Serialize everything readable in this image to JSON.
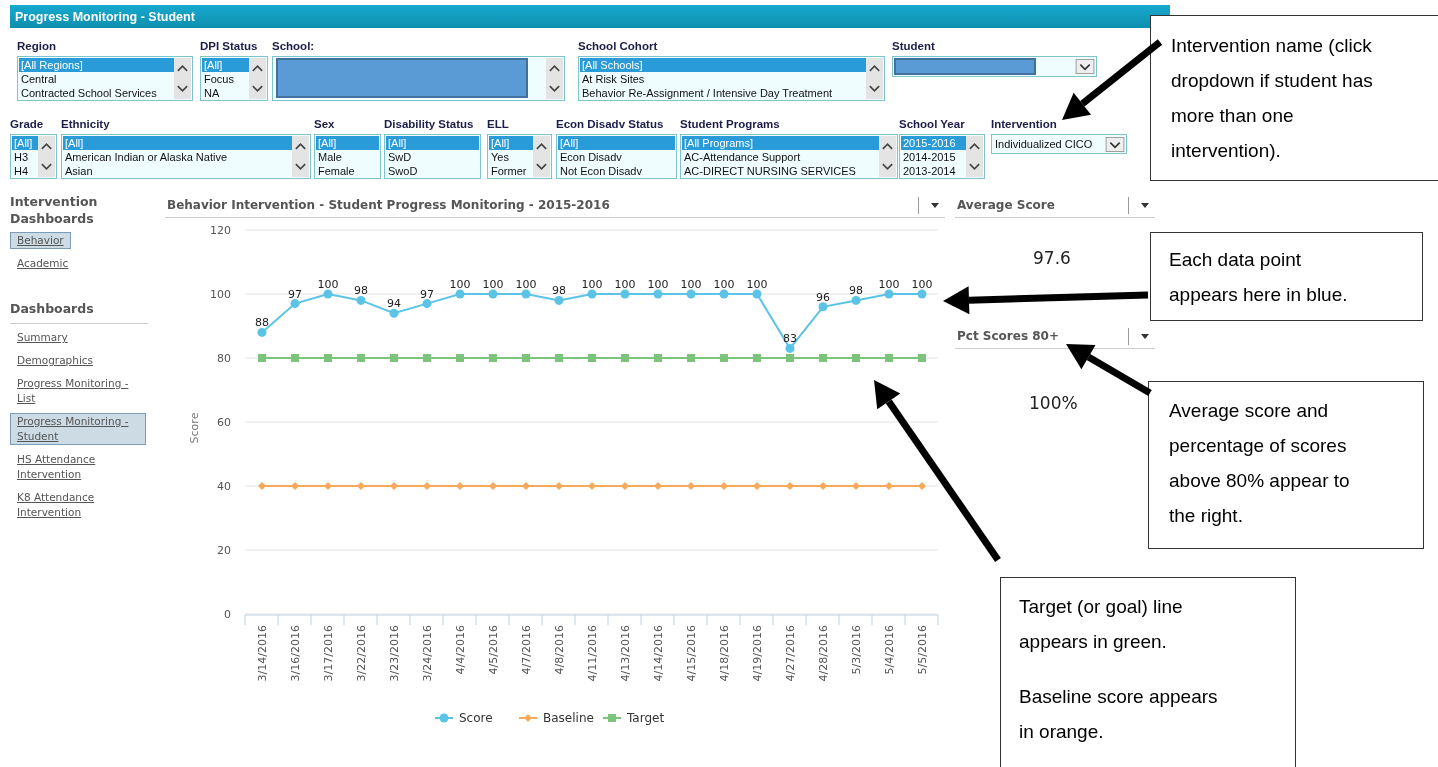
{
  "window": {
    "title": "Progress Monitoring - Student"
  },
  "filters_top": [
    {
      "kind": "list",
      "label": "Region",
      "scrollbar": true,
      "options": [
        {
          "text": "[All Regions]",
          "selected": true
        },
        {
          "text": "Central",
          "selected": false
        },
        {
          "text": "Contracted School Services",
          "selected": false
        }
      ]
    },
    {
      "kind": "list",
      "label": "DPI Status",
      "scrollbar": true,
      "options": [
        {
          "text": "[All]",
          "selected": true
        },
        {
          "text": "Focus",
          "selected": false
        },
        {
          "text": "NA",
          "selected": false
        }
      ]
    },
    {
      "kind": "redacted_list",
      "label": "School:",
      "scrollbar": true
    },
    {
      "kind": "list",
      "label": "School Cohort",
      "scrollbar": true,
      "options": [
        {
          "text": "[All Schools]",
          "selected": true
        },
        {
          "text": "At Risk Sites",
          "selected": false
        },
        {
          "text": "Behavior Re-Assignment / Intensive Day Treatment",
          "selected": false
        }
      ]
    },
    {
      "kind": "redacted_dropdown",
      "label": "Student"
    }
  ],
  "filters_bottom": [
    {
      "kind": "list",
      "label": "Grade",
      "scrollbar": true,
      "options": [
        {
          "text": "[All]",
          "selected": true
        },
        {
          "text": "H3",
          "selected": false
        },
        {
          "text": "H4",
          "selected": false
        }
      ]
    },
    {
      "kind": "list",
      "label": "Ethnicity",
      "scrollbar": true,
      "options": [
        {
          "text": "[All]",
          "selected": true
        },
        {
          "text": "American Indian or Alaska Native",
          "selected": false
        },
        {
          "text": "Asian",
          "selected": false
        }
      ]
    },
    {
      "kind": "list",
      "label": "Sex",
      "scrollbar": false,
      "options": [
        {
          "text": "[All]",
          "selected": true
        },
        {
          "text": "Male",
          "selected": false
        },
        {
          "text": "Female",
          "selected": false
        }
      ]
    },
    {
      "kind": "list",
      "label": "Disability Status",
      "scrollbar": false,
      "options": [
        {
          "text": "[All]",
          "selected": true
        },
        {
          "text": "SwD",
          "selected": false
        },
        {
          "text": "SwoD",
          "selected": false
        }
      ]
    },
    {
      "kind": "list",
      "label": "ELL",
      "scrollbar": true,
      "options": [
        {
          "text": "[All]",
          "selected": true
        },
        {
          "text": "Yes",
          "selected": false
        },
        {
          "text": "Former",
          "selected": false
        }
      ]
    },
    {
      "kind": "list",
      "label": "Econ Disadv Status",
      "scrollbar": false,
      "options": [
        {
          "text": "[All]",
          "selected": true
        },
        {
          "text": "Econ Disadv",
          "selected": false
        },
        {
          "text": "Not Econ Disadv",
          "selected": false
        }
      ]
    },
    {
      "kind": "list",
      "label": "Student Programs",
      "scrollbar": true,
      "options": [
        {
          "text": "[All Programs]",
          "selected": true
        },
        {
          "text": "AC-Attendance Support",
          "selected": false
        },
        {
          "text": "AC-DIRECT NURSING SERVICES",
          "selected": false
        }
      ]
    },
    {
      "kind": "list",
      "label": "School Year",
      "scrollbar": true,
      "options": [
        {
          "text": "2015-2016",
          "selected": true
        },
        {
          "text": "2014-2015",
          "selected": false
        },
        {
          "text": "2013-2014",
          "selected": false
        }
      ]
    },
    {
      "kind": "dropdown",
      "label": "Intervention",
      "value": "Individualized CICO"
    }
  ],
  "sidebar": {
    "sections": [
      {
        "title": "Intervention Dashboards",
        "items": [
          {
            "label": "Behavior",
            "selected": true
          },
          {
            "label": "Academic",
            "selected": false
          }
        ]
      },
      {
        "title": "Dashboards",
        "items": [
          {
            "label": "Summary",
            "selected": false
          },
          {
            "label": "Demographics",
            "selected": false
          },
          {
            "label": "Progress Monitoring - List",
            "selected": false
          },
          {
            "label": "Progress Monitoring - Student",
            "selected": true
          },
          {
            "label": "HS Attendance Intervention",
            "selected": false
          },
          {
            "label": "K8 Attendance Intervention",
            "selected": false
          }
        ]
      }
    ]
  },
  "chart_panel": {
    "title": "Behavior Intervention - Student Progress Monitoring - 2015-2016",
    "chart_data": {
      "type": "line",
      "ylabel": "Score",
      "ylim": [
        0,
        120
      ],
      "yticks": [
        0,
        20,
        40,
        60,
        80,
        100,
        120
      ],
      "grid": true,
      "legend": "bottom",
      "categories": [
        "3/14/2016",
        "3/16/2016",
        "3/17/2016",
        "3/22/2016",
        "3/23/2016",
        "3/24/2016",
        "4/4/2016",
        "4/5/2016",
        "4/7/2016",
        "4/8/2016",
        "4/11/2016",
        "4/13/2016",
        "4/14/2016",
        "4/15/2016",
        "4/18/2016",
        "4/19/2016",
        "4/27/2016",
        "4/28/2016",
        "5/3/2016",
        "5/4/2016",
        "5/5/2016"
      ],
      "series": [
        {
          "name": "Score",
          "color": "#5bc4e6",
          "marker": "circle",
          "values": [
            88,
            97,
            100,
            98,
            94,
            97,
            100,
            100,
            100,
            98,
            100,
            100,
            100,
            100,
            100,
            100,
            83,
            96,
            98,
            100,
            100
          ],
          "value_labels": [
            "88",
            "97",
            "100",
            "98",
            "94",
            "97",
            "100",
            "100",
            "100",
            "98",
            "100",
            "100",
            "100",
            "100",
            "100",
            "100",
            "83",
            "96",
            "98",
            "100",
            "100"
          ]
        },
        {
          "name": "Baseline",
          "color": "#f5a95a",
          "marker": "diamond",
          "values": [
            40,
            40,
            40,
            40,
            40,
            40,
            40,
            40,
            40,
            40,
            40,
            40,
            40,
            40,
            40,
            40,
            40,
            40,
            40,
            40,
            40
          ]
        },
        {
          "name": "Target",
          "color": "#7cc47c",
          "marker": "square",
          "values": [
            80,
            80,
            80,
            80,
            80,
            80,
            80,
            80,
            80,
            80,
            80,
            80,
            80,
            80,
            80,
            80,
            80,
            80,
            80,
            80,
            80
          ]
        }
      ]
    }
  },
  "kpis": [
    {
      "title": "Average Score",
      "value": "97.6"
    },
    {
      "title": "Pct Scores 80+",
      "value": "100%"
    }
  ],
  "callouts": [
    {
      "paragraphs": [
        "Intervention name (click dropdown if student has more than one intervention)."
      ]
    },
    {
      "paragraphs": [
        "Each data point appears here in blue."
      ]
    },
    {
      "paragraphs": [
        "Average score and percentage of scores above 80% appear to the right."
      ]
    },
    {
      "paragraphs": [
        "Target (or goal) line appears in green.",
        "Baseline score appears in orange."
      ]
    }
  ]
}
